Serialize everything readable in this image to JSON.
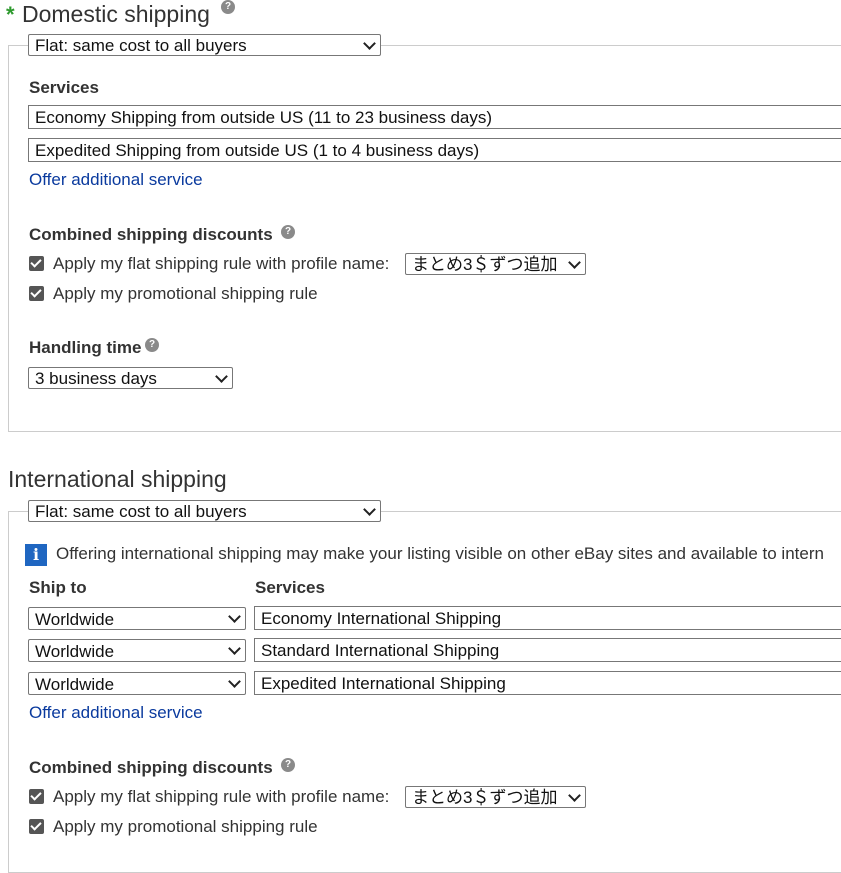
{
  "domestic": {
    "required_marker": "*",
    "title": "Domestic shipping",
    "help_icon": "?",
    "cost_type": "Flat: same cost to all buyers",
    "services_label": "Services",
    "services": [
      "Economy Shipping from outside US (11 to 23 business days)",
      "Expedited Shipping from outside US (1 to 4 business days)"
    ],
    "offer_link": "Offer additional service",
    "combined_label": "Combined shipping discounts",
    "flat_rule_label": "Apply my flat shipping rule with profile name:",
    "flat_rule_profile": "まとめ3＄ずつ追加",
    "promo_rule_label": "Apply my promotional shipping rule",
    "handling_label": "Handling time",
    "handling_value": "3 business days"
  },
  "international": {
    "title": "International shipping",
    "cost_type": "Flat: same cost to all buyers",
    "info_icon": "i",
    "info_text": "Offering international shipping may make your listing visible on other eBay sites and available to intern",
    "ship_to_label": "Ship to",
    "services_label": "Services",
    "rows": [
      {
        "ship_to": "Worldwide",
        "service": "Economy International Shipping"
      },
      {
        "ship_to": "Worldwide",
        "service": "Standard International Shipping"
      },
      {
        "ship_to": "Worldwide",
        "service": "Expedited International Shipping"
      }
    ],
    "offer_link": "Offer additional service",
    "combined_label": "Combined shipping discounts",
    "flat_rule_label": "Apply my flat shipping rule with profile name:",
    "flat_rule_profile": "まとめ3＄ずつ追加",
    "promo_rule_label": "Apply my promotional shipping rule"
  },
  "colors": {
    "required": "#2e9a2e",
    "link": "#0a3a9e",
    "info": "#1f66c1"
  }
}
